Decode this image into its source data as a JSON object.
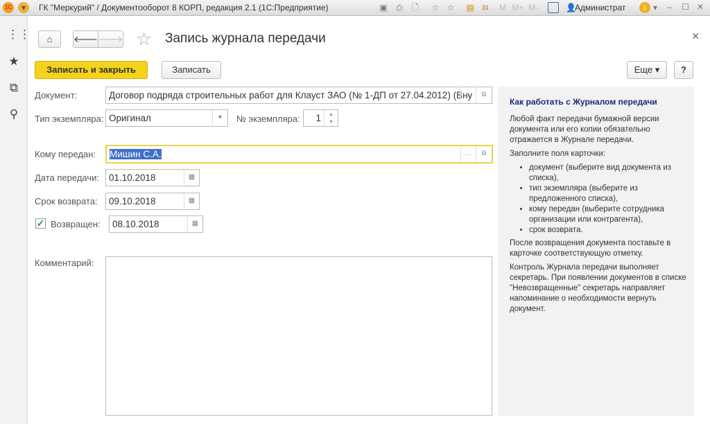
{
  "window": {
    "title": "ГК \"Меркурий\" / Документооборот 8 КОРП, редакция 2.1  (1С:Предприятие)",
    "user": "Администрат",
    "toolbar_labels": [
      "M",
      "M+",
      "M-"
    ]
  },
  "form": {
    "title": "Запись журнала передачи",
    "save_close": "Записать и закрыть",
    "save": "Записать",
    "more": "Еще",
    "help": "?",
    "close": "×"
  },
  "fields": {
    "document": {
      "label": "Документ:",
      "value": "Договор подряда строительных работ для Клауст ЗАО (№ 1-ДП от 27.04.2012) (Вну"
    },
    "copy_type": {
      "label": "Тип экземпляра:",
      "value": "Оригинал"
    },
    "copy_no": {
      "label": "№ экземпляра:",
      "value": "1"
    },
    "recipient": {
      "label": "Кому передан:",
      "value": "Мишин С.А."
    },
    "transfer_date": {
      "label": "Дата передачи:",
      "value": "01.10.2018"
    },
    "return_due": {
      "label": "Срок возврата:",
      "value": "09.10.2018"
    },
    "returned": {
      "label": "Возвращен:",
      "checked": true,
      "value": "08.10.2018"
    },
    "comment": {
      "label": "Комментарий:",
      "value": ""
    }
  },
  "help": {
    "title": "Как работать с Журналом передачи",
    "p1": "Любой факт передачи бумажной версии документа или его копии обязательно отражается в Журнале передачи.",
    "p2": "Заполните поля карточки:",
    "items": [
      "документ (выберите вид документа из списка),",
      "тип экземпляра (выберите из предложенного списка),",
      "кому передан (выберите сотрудника организации или контрагента),",
      "срок возврата."
    ],
    "p3": "После возвращения документа поставьте в карточке соответствующую отметку.",
    "p4": "Контроль Журнала передачи выполняет секретарь. При появлении документов в списке \"Невозвращенные\" секретарь направляет напоминание о необходимости вернуть документ."
  },
  "colors": {
    "primary_button": "#f5d21c",
    "focus_border": "#e8d44a",
    "help_title": "#1a2a7a",
    "selection": "#3f6fc6"
  }
}
